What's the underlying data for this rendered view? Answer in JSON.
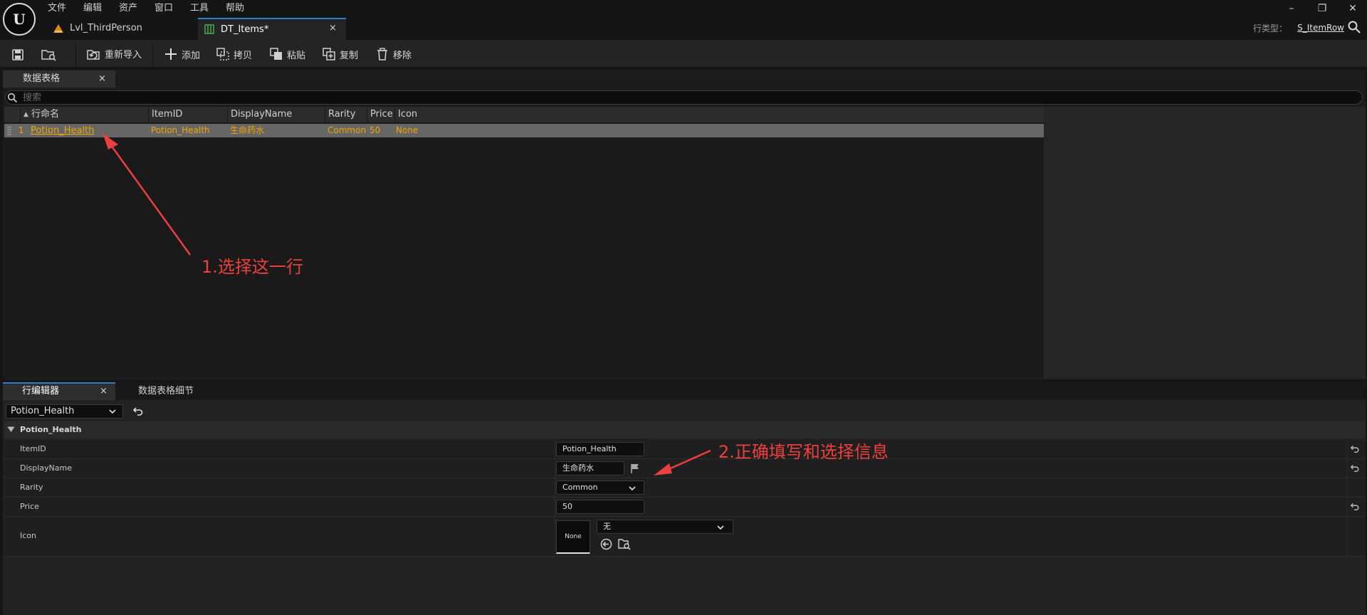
{
  "menu": {
    "items": [
      "文件",
      "编辑",
      "资产",
      "窗口",
      "工具",
      "帮助"
    ]
  },
  "logo_text": "U",
  "tabs": [
    {
      "label": "Lvl_ThirdPerson"
    },
    {
      "label": "DT_Items*"
    }
  ],
  "tab_close": "×",
  "window_controls": {
    "minimize": "–",
    "restore": "❐",
    "close": "✕"
  },
  "row_type": {
    "label": "行类型：",
    "value": "S_ItemRow"
  },
  "toolbar": {
    "reimport": "重新导入",
    "add": "添加",
    "copy": "拷贝",
    "paste": "粘贴",
    "duplicate": "复制",
    "remove": "移除"
  },
  "data_table": {
    "tab_label": "数据表格",
    "search_placeholder": "搜索",
    "sort_indicator": "▲",
    "columns": [
      "行命名",
      "ItemID",
      "DisplayName",
      "Rarity",
      "Price",
      "Icon"
    ],
    "rows": [
      {
        "index": "1",
        "name": "Potion_Health",
        "item_id": "Potion_Health",
        "display_name": "生命药水",
        "rarity": "Common",
        "price": "50",
        "icon": "None"
      }
    ]
  },
  "row_editor": {
    "tab_label": "行编辑器",
    "details_tab_label": "数据表格细节",
    "selected_row": "Potion_Health",
    "section_title": "Potion_Health",
    "properties": {
      "item_id": {
        "label": "ItemID",
        "value": "Potion_Health"
      },
      "display_name": {
        "label": "DisplayName",
        "value": "生命药水"
      },
      "rarity": {
        "label": "Rarity",
        "value": "Common"
      },
      "price": {
        "label": "Price",
        "value": "50"
      },
      "icon": {
        "label": "Icon",
        "thumbnail": "None",
        "asset_value": "无"
      }
    }
  },
  "annotations": {
    "step1": "1.选择这一行",
    "step2": "2.正确填写和选择信息",
    "color": "#ec3f3f"
  },
  "colors": {
    "accent": "#2a7fd4",
    "selected_row_text": "#f0a500",
    "selected_row_bg": "#666666"
  }
}
